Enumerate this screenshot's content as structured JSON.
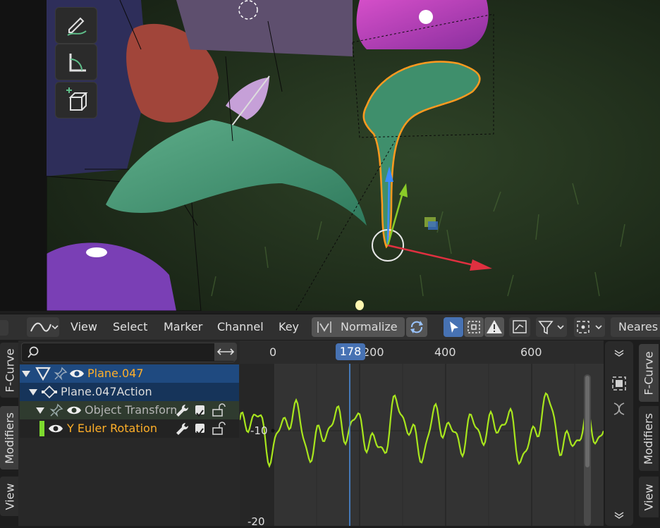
{
  "header": {
    "editor_type_icon": "graph-editor-icon",
    "menus": [
      "View",
      "Select",
      "Marker",
      "Channel",
      "Key"
    ],
    "normalize_label": "Normalize",
    "interpolation_label": "Neares"
  },
  "channels": {
    "search_placeholder": "",
    "items": [
      {
        "label": "Plane.047",
        "color": "#ffaf29"
      },
      {
        "label": "Plane.047Action",
        "color": "#dcdcdc"
      },
      {
        "label": "Object Transform",
        "color": "#b4b4b4"
      },
      {
        "label": "Y Euler Rotation",
        "color": "#ffaf29",
        "channel_color": "#7dd92e"
      }
    ]
  },
  "timeline": {
    "frame_ticks": [
      "0",
      "200",
      "400",
      "600"
    ],
    "current_frame": "178"
  },
  "graph": {
    "y_labels": [
      "-10",
      "-20"
    ],
    "curve_color": "#a8e61d"
  },
  "left_tabs": [
    "F-Curve",
    "Modifiers",
    "View"
  ],
  "right_tabs": [
    "F-Curve",
    "Modifiers",
    "View"
  ],
  "viewport_tools": [
    "annotate-icon",
    "measure-icon",
    "add-cube-icon"
  ],
  "colors": {
    "accent": "#4772b3",
    "selection_outline": "#ff9a1f",
    "active_text": "#ffaf29"
  }
}
